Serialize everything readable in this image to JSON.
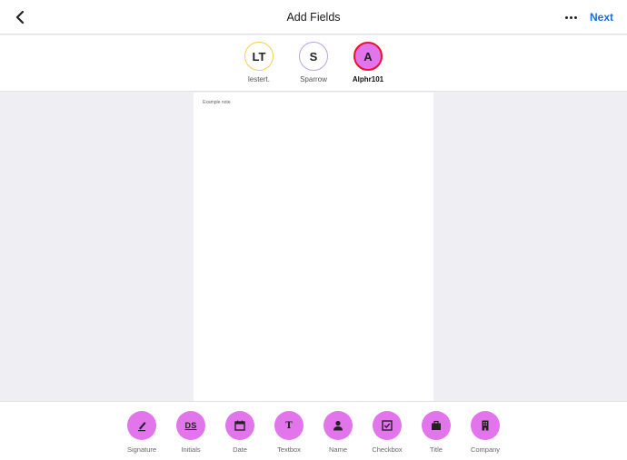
{
  "header": {
    "title": "Add Fields",
    "next_label": "Next",
    "back_icon": "chevron-left-icon",
    "more_icon": "more-horizontal-icon"
  },
  "recipients": [
    {
      "initials": "LT",
      "name": "lestert.",
      "ring_color": "#f3cf55",
      "fill_color": "#ffffff",
      "active": false
    },
    {
      "initials": "S",
      "name": "Sparrow",
      "ring_color": "#b9a4e4",
      "fill_color": "#ffffff",
      "active": false
    },
    {
      "initials": "A",
      "name": "Alphr101",
      "ring_color": "#e8132a",
      "fill_color": "#e274ec",
      "active": true
    }
  ],
  "document": {
    "text": "Example note"
  },
  "fields": [
    {
      "label": "Signature",
      "icon": "pen-icon"
    },
    {
      "label": "Initials",
      "icon": "initials-icon"
    },
    {
      "label": "Date",
      "icon": "calendar-icon"
    },
    {
      "label": "Textbox",
      "icon": "text-icon"
    },
    {
      "label": "Name",
      "icon": "person-icon"
    },
    {
      "label": "Checkbox",
      "icon": "checkbox-icon"
    },
    {
      "label": "Title",
      "icon": "briefcase-icon"
    },
    {
      "label": "Company",
      "icon": "building-icon"
    }
  ],
  "colors": {
    "accent": "#1a6fd9",
    "field_fill": "#e274ec",
    "background": "#efeef3"
  }
}
